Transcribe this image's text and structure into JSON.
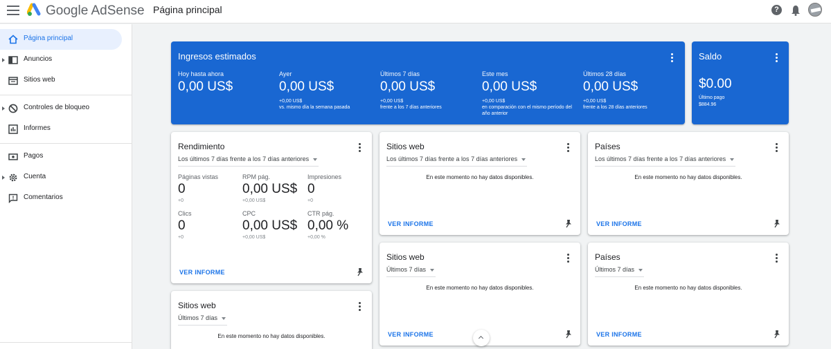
{
  "brand": {
    "name": "Google AdSense"
  },
  "header": {
    "title": "Página principal",
    "help_icon": "help-icon",
    "notifications_icon": "bell-icon"
  },
  "sidebar": {
    "items": [
      {
        "label": "Página principal",
        "icon": "home-icon",
        "active": true
      },
      {
        "label": "Anuncios",
        "icon": "ads-icon",
        "expandable": true
      },
      {
        "label": "Sitios web",
        "icon": "sites-icon"
      },
      {
        "label": "Controles de bloqueo",
        "icon": "block-icon",
        "expandable": true
      },
      {
        "label": "Informes",
        "icon": "reports-icon"
      },
      {
        "label": "Pagos",
        "icon": "payments-icon"
      },
      {
        "label": "Cuenta",
        "icon": "gear-icon",
        "expandable": true
      },
      {
        "label": "Comentarios",
        "icon": "feedback-icon"
      }
    ]
  },
  "ingresos": {
    "title": "Ingresos estimados",
    "stats": [
      {
        "label": "Hoy hasta ahora",
        "value": "0,00 US$",
        "delta": "",
        "note": ""
      },
      {
        "label": "Ayer",
        "value": "0,00 US$",
        "delta": "+0,00 US$",
        "note": "vs. mismo día la semana pasada"
      },
      {
        "label": "Últimos 7 días",
        "value": "0,00 US$",
        "delta": "+0,00 US$",
        "note": "frente a los 7 días anteriores"
      },
      {
        "label": "Este mes",
        "value": "0,00 US$",
        "delta": "+0,00 US$",
        "note": "en comparación con el mismo período del año anterior"
      },
      {
        "label": "Últimos 28 días",
        "value": "0,00 US$",
        "delta": "+0,00 US$",
        "note": "frente a los 28 días anteriores"
      }
    ]
  },
  "saldo": {
    "title": "Saldo",
    "value": "$0.00",
    "last_payment_label": "Último pago",
    "last_payment_value": "$884.96"
  },
  "rendimiento": {
    "title": "Rendimiento",
    "range": "Los últimos 7 días frente a los 7 días anteriores",
    "metrics": [
      {
        "label": "Páginas vistas",
        "value": "0",
        "delta": "+0"
      },
      {
        "label": "RPM pág.",
        "value": "0,00 US$",
        "delta": "+0,00 US$"
      },
      {
        "label": "Impresiones",
        "value": "0",
        "delta": "+0"
      },
      {
        "label": "Clics",
        "value": "0",
        "delta": "+0"
      },
      {
        "label": "CPC",
        "value": "0,00 US$",
        "delta": "+0,00 US$"
      },
      {
        "label": "CTR pág.",
        "value": "0,00 %",
        "delta": "+0,00 %"
      }
    ],
    "link": "VER INFORME"
  },
  "cards": {
    "sitios_compare": {
      "title": "Sitios web",
      "range": "Los últimos 7 días frente a los 7 días anteriores",
      "nodata": "En este momento no hay datos disponibles.",
      "link": "VER INFORME"
    },
    "paises_compare": {
      "title": "Países",
      "range": "Los últimos 7 días frente a los 7 días anteriores",
      "nodata": "En este momento no hay datos disponibles.",
      "link": "VER INFORME"
    },
    "sitios_7d": {
      "title": "Sitios web",
      "range": "Últimos 7 días",
      "nodata": "En este momento no hay datos disponibles.",
      "link": "VER INFORME"
    },
    "paises_7d": {
      "title": "Países",
      "range": "Últimos 7 días",
      "nodata": "En este momento no hay datos disponibles.",
      "link": "VER INFORME"
    },
    "sitios_bottom": {
      "title": "Sitios web",
      "range": "Últimos 7 días",
      "nodata": "En este momento no hay datos disponibles."
    }
  },
  "colors": {
    "accent": "#1a73e8",
    "earnings_card": "#1967d2",
    "background": "#f1f3f4"
  }
}
